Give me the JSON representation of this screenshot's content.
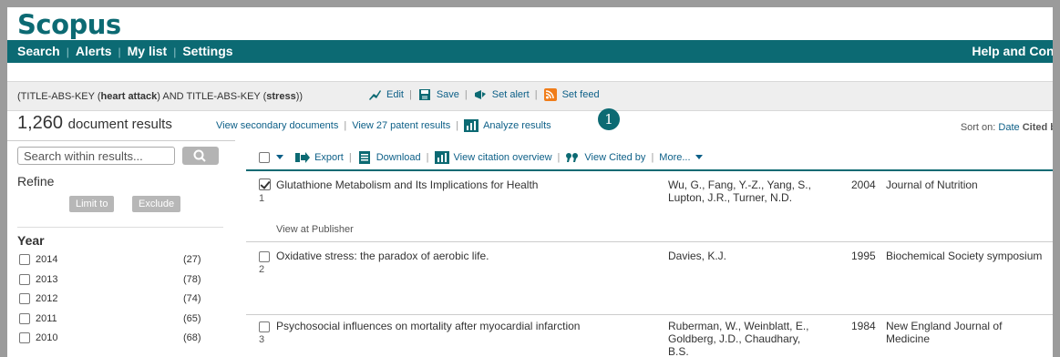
{
  "header": {
    "logo": "Scopus",
    "nav": [
      "Search",
      "Alerts",
      "My list",
      "Settings"
    ],
    "help": "Help and Conta"
  },
  "query": {
    "prefix": "(TITLE-ABS-KEY (",
    "term1": "heart attack",
    "middle": ") AND TITLE-ABS-KEY (",
    "term2": "stress",
    "suffix": "))",
    "actions": {
      "edit": "Edit",
      "save": "Save",
      "set_alert": "Set alert",
      "set_feed": "Set feed"
    }
  },
  "results": {
    "count": "1,260",
    "count_label": "document results",
    "secondary": "View secondary documents",
    "patents": "View 27 patent results",
    "analyze": "Analyze results",
    "badge": "1",
    "sort_label": "Sort on:",
    "sort_date": "Date",
    "sort_cited": "Cited b"
  },
  "refine": {
    "search_placeholder": "Search within results...",
    "title": "Refine",
    "limit_to": "Limit to",
    "exclude": "Exclude",
    "year_title": "Year",
    "years": [
      {
        "year": "2014",
        "count": "(27)"
      },
      {
        "year": "2013",
        "count": "(78)"
      },
      {
        "year": "2012",
        "count": "(74)"
      },
      {
        "year": "2011",
        "count": "(65)"
      },
      {
        "year": "2010",
        "count": "(68)"
      }
    ]
  },
  "toolbar": {
    "export": "Export",
    "download": "Download",
    "citation_overview": "View citation overview",
    "cited_by": "View Cited by",
    "more": "More..."
  },
  "documents": [
    {
      "num": "1",
      "title": "Glutathione Metabolism and Its Implications for Health",
      "authors_l1": "Wu, G., Fang, Y.-Z., Yang, S.,",
      "authors_l2": "Lupton, J.R., Turner, N.D.",
      "authors_l3": "",
      "year": "2004",
      "source_l1": "Journal of Nutrition",
      "source_l2": "",
      "view_at_publisher": "View at Publisher"
    },
    {
      "num": "2",
      "title": "Oxidative stress: the paradox of aerobic life.",
      "authors_l1": "Davies, K.J.",
      "authors_l2": "",
      "authors_l3": "",
      "year": "1995",
      "source_l1": "Biochemical Society symposium",
      "source_l2": ""
    },
    {
      "num": "3",
      "title": "Psychosocial influences on mortality after myocardial infarction",
      "authors_l1": "Ruberman, W., Weinblatt, E.,",
      "authors_l2": "Goldberg, J.D., Chaudhary,",
      "authors_l3": "B.S.",
      "year": "1984",
      "source_l1": "New England Journal of",
      "source_l2": "Medicine"
    }
  ],
  "colors": {
    "brand": "#0c6a73",
    "link": "#0c5f87",
    "frame_bg": "#9b9b9b"
  }
}
